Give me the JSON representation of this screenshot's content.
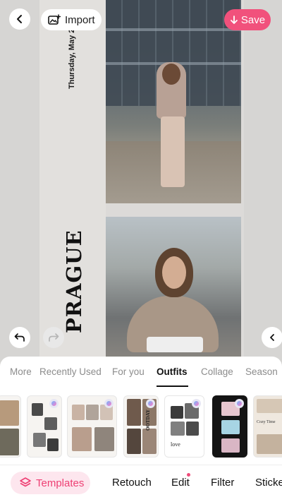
{
  "header": {
    "import_label": "Import",
    "save_label": "Save",
    "accent": "#f1517c"
  },
  "canvas": {
    "date_text": "Thursday, May 2",
    "city_text": "PRAGUE"
  },
  "categories": {
    "tabs": [
      {
        "label": "More"
      },
      {
        "label": "Recently Used"
      },
      {
        "label": "For you"
      },
      {
        "label": "Outfits"
      },
      {
        "label": "Collage"
      },
      {
        "label": "Season"
      }
    ],
    "active": "Outfits"
  },
  "thumbnails": {
    "thumb4_text": "OOTDAY",
    "thumb5_text": "love",
    "thumb7_text": "Cozy Time"
  },
  "toolbar": {
    "templates_label": "Templates",
    "retouch_label": "Retouch",
    "edit_label": "Edit",
    "filter_label": "Filter",
    "stickers_label": "Sticke"
  }
}
